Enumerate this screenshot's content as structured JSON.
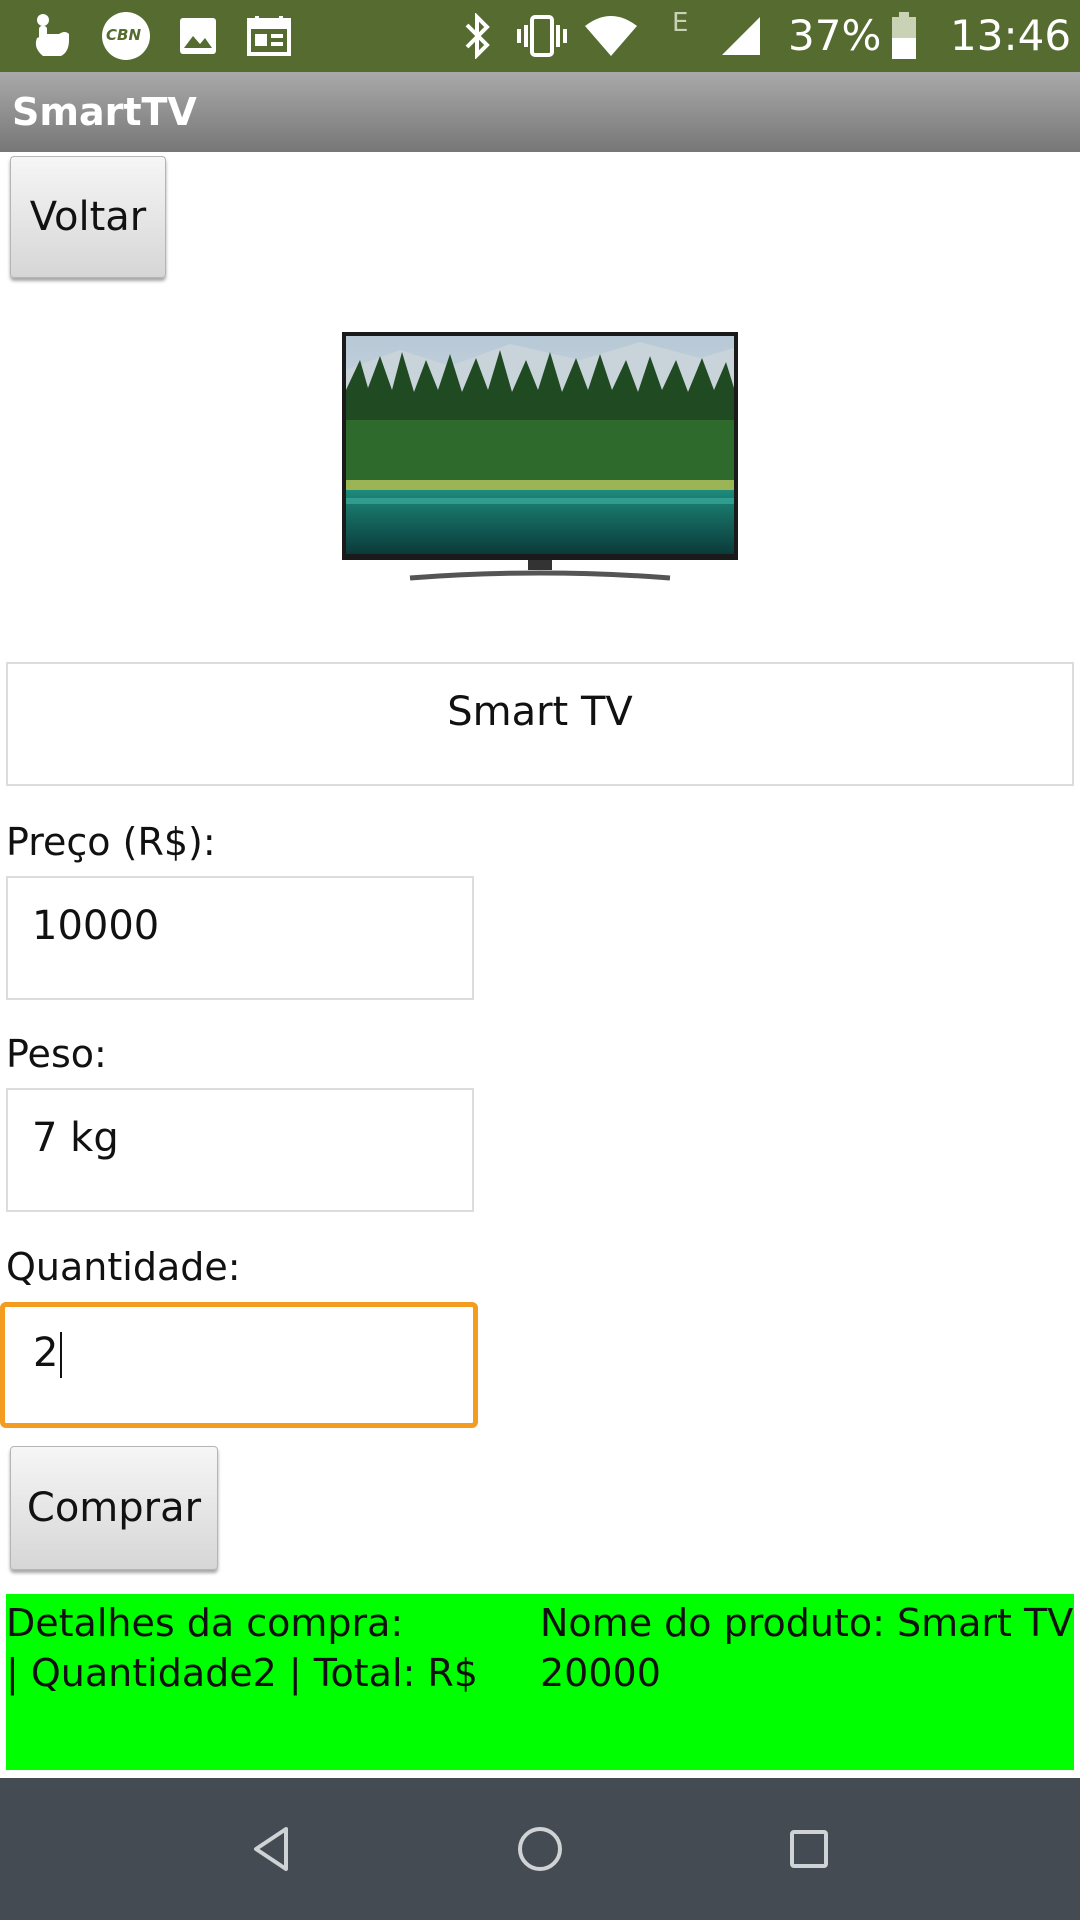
{
  "status_bar": {
    "network_letter": "E",
    "battery_percent": "37%",
    "time": "13:46",
    "icons": [
      "touch-hand-icon",
      "cbn-icon",
      "image-icon",
      "calendar-icon",
      "bluetooth-icon",
      "vibrate-icon",
      "wifi-icon",
      "signal-icon",
      "battery-icon"
    ],
    "cbn_text": "CBN"
  },
  "app_bar": {
    "title": "SmartTV"
  },
  "back_button": {
    "label": "Voltar"
  },
  "product_image": {
    "icon": "smart-tv-image"
  },
  "product_name": {
    "value": "Smart TV"
  },
  "price": {
    "label": "Preço (R$):",
    "value": "10000"
  },
  "weight": {
    "label": "Peso:",
    "value": "7 kg"
  },
  "quantity": {
    "label": "Quantidade:",
    "value": "2"
  },
  "buy_button": {
    "label": "Comprar"
  },
  "details": {
    "line1_left": "Detalhes da compra:",
    "line1_right": "Nome do produto:  Smart TV",
    "line2_left": "|   Quantidade2   |   Total: R$",
    "line2_right": "20000"
  },
  "colors": {
    "status_bar": "#556b2f",
    "details_bg": "#00ff00",
    "focus_border": "#f39c1f",
    "nav_bar": "#454b52"
  },
  "nav_bar": {
    "icons": [
      "back-triangle-icon",
      "home-circle-icon",
      "recents-square-icon"
    ]
  }
}
